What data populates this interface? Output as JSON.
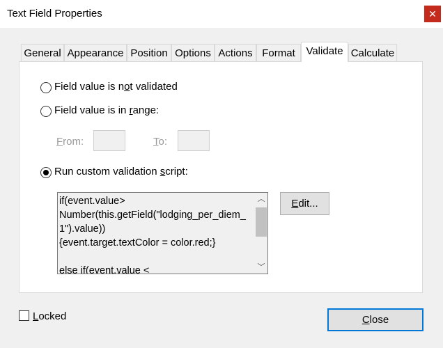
{
  "window": {
    "title": "Text Field Properties",
    "close_glyph": "✕"
  },
  "tabs": [
    {
      "label": "General"
    },
    {
      "label": "Appearance"
    },
    {
      "label": "Position"
    },
    {
      "label": "Options"
    },
    {
      "label": "Actions"
    },
    {
      "label": "Format"
    },
    {
      "label": "Validate",
      "active": true
    },
    {
      "label": "Calculate"
    }
  ],
  "validate": {
    "option_none": {
      "prefix": "Field value is n",
      "mnemonic": "o",
      "suffix": "t validated",
      "selected": false
    },
    "option_range": {
      "prefix": "Field value is in ",
      "mnemonic": "r",
      "suffix": "ange:",
      "selected": false
    },
    "range": {
      "from_mnemonic": "F",
      "from_rest": "rom:",
      "from_value": "",
      "to_mnemonic": "T",
      "to_rest": "o:",
      "to_value": ""
    },
    "option_script": {
      "prefix": "Run custom validation ",
      "mnemonic": "s",
      "suffix": "cript:",
      "selected": true
    },
    "script_text": "if(event.value>\nNumber(this.getField(\"lodging_per_diem_\n1\").value))\n{event.target.textColor = color.red;}\n\nelse if(event.value <",
    "edit_button": {
      "mnemonic": "E",
      "rest": "dit..."
    }
  },
  "footer": {
    "locked": {
      "mnemonic": "L",
      "rest": "ocked",
      "checked": false
    },
    "close_button": {
      "mnemonic": "C",
      "rest": "lose"
    }
  },
  "colors": {
    "close_red": "#c42b1c",
    "focus_blue": "#0078d7",
    "panel_bg": "#ffffff",
    "dialog_bg": "#f0f0f0"
  },
  "icons": {
    "close": "close-icon",
    "scroll_up": "chevron-up-icon",
    "scroll_down": "chevron-down-icon"
  }
}
